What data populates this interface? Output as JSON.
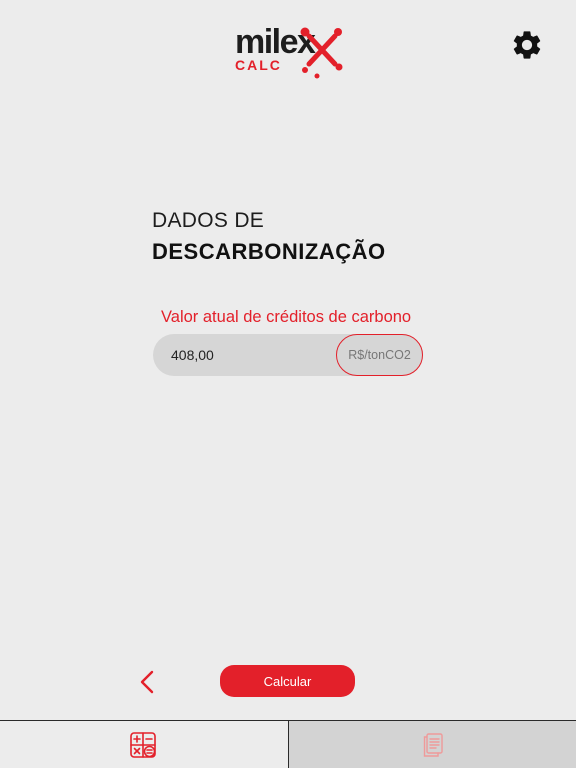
{
  "header": {
    "logo_word": "milex",
    "logo_sub": "CALC",
    "settings_icon": "gear-icon"
  },
  "title": {
    "line1": "DADOS DE",
    "line2": "DESCARBONIZAÇÃO"
  },
  "field": {
    "label": "Valor atual de créditos de carbono",
    "value": "408,00",
    "unit": "R$/tonCO2"
  },
  "actions": {
    "back_icon": "chevron-left-icon",
    "calculate_label": "Calcular"
  },
  "tabbar": {
    "tabs": [
      {
        "icon": "calculator-icon",
        "active": true
      },
      {
        "icon": "report-icon",
        "active": false
      }
    ]
  },
  "colors": {
    "accent": "#e3202a",
    "background": "#ececec",
    "field_bg": "#d6d6d6",
    "text_dark": "#1d1d1d"
  }
}
